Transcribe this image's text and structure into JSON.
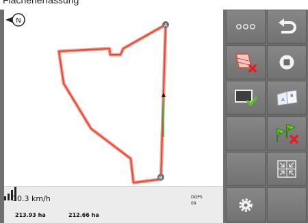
{
  "caption": {
    "text": "Flächenerfassung"
  },
  "map": {
    "point_a_label": "A",
    "point_b_label": "B",
    "compass_label": "N"
  },
  "status": {
    "speed": "10.3 km/h",
    "area_total": "213.93 ha",
    "area_worked": "212.66 ha",
    "gps_mode": "DGPS",
    "satellites": "09",
    "signal_bars": 4
  },
  "softkeys": [
    {
      "name": "more-options-button",
      "icon": "three-dots-icon"
    },
    {
      "name": "back-button",
      "icon": "return-arrow-icon"
    },
    {
      "name": "delete-field-boundary-button",
      "icon": "boundary-delete-icon"
    },
    {
      "name": "stop-recording-button",
      "icon": "stop-icon"
    },
    {
      "name": "confirm-boundary-button",
      "icon": "screen-check-icon"
    },
    {
      "name": "ab-guidance-button",
      "icon": "ab-flag-icon"
    },
    {
      "name": "empty-softkey-1",
      "icon": ""
    },
    {
      "name": "delete-ab-line-button",
      "icon": "ab-flags-delete-icon"
    },
    {
      "name": "empty-softkey-2",
      "icon": ""
    },
    {
      "name": "zoom-extents-button",
      "icon": "fit-view-icon"
    },
    {
      "name": "settings-button",
      "icon": "gear-icon"
    },
    {
      "name": "empty-softkey-3",
      "icon": ""
    }
  ],
  "colors": {
    "boundary": "#e8452f",
    "track": "#35c23a",
    "delete": "#e02020",
    "confirm": "#5cc020"
  }
}
